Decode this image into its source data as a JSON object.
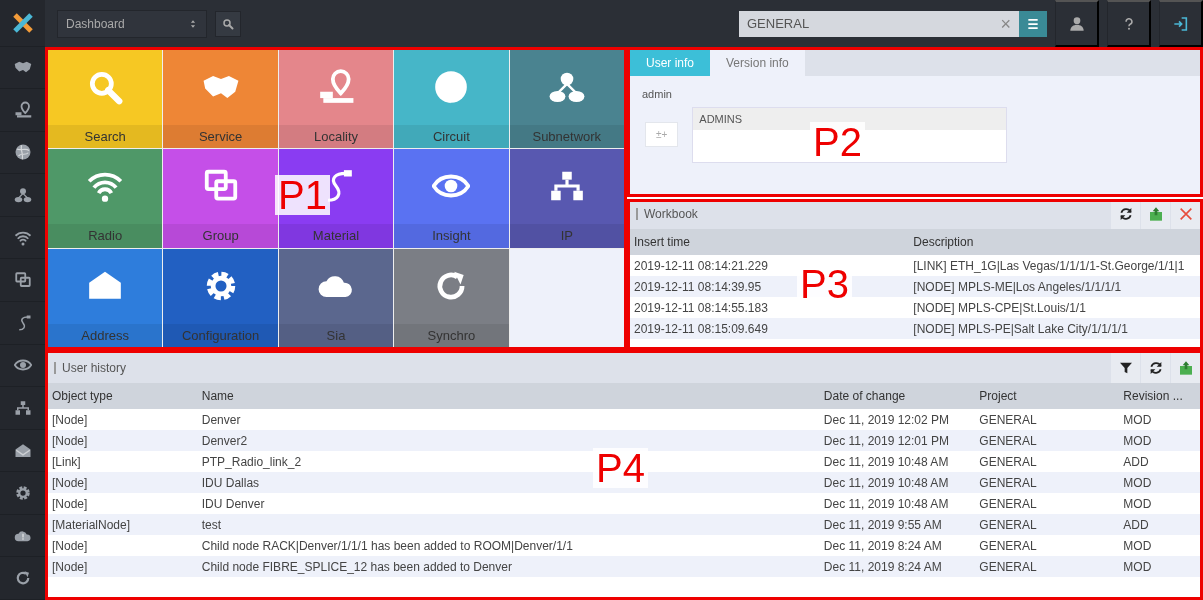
{
  "topbar": {
    "view_select": {
      "value": "Dashboard"
    },
    "project_field": {
      "value": "GENERAL",
      "clear": "×"
    }
  },
  "tiles": [
    {
      "label": "Search",
      "color": "#f6c823"
    },
    {
      "label": "Service",
      "color": "#ee8636"
    },
    {
      "label": "Locality",
      "color": "#e4868b"
    },
    {
      "label": "Circuit",
      "color": "#46b6c8"
    },
    {
      "label": "Subnetwork",
      "color": "#4a8390"
    },
    {
      "label": "Radio",
      "color": "#4f9868"
    },
    {
      "label": "Group",
      "color": "#c54fe8"
    },
    {
      "label": "Material",
      "color": "#8a3cf2"
    },
    {
      "label": "Insight",
      "color": "#5a72f2"
    },
    {
      "label": "IP",
      "color": "#5858b0"
    },
    {
      "label": "Address",
      "color": "#2e7ddc"
    },
    {
      "label": "Configuration",
      "color": "#2260c2"
    },
    {
      "label": "Sia",
      "color": "#5b678e"
    },
    {
      "label": "Synchro",
      "color": "#7b7e85"
    }
  ],
  "user_panel": {
    "tabs": [
      {
        "label": "User info",
        "selected": true
      },
      {
        "label": "Version info",
        "selected": false
      }
    ],
    "username": "admin",
    "add_button": "±+",
    "groups": [
      "ADMINS"
    ]
  },
  "workbook": {
    "title": "Workbook",
    "columns": [
      "Insert time",
      "Description"
    ],
    "rows": [
      [
        "2019-12-11 08:14:21.229",
        "[LINK] ETH_1G|Las Vegas/1/1/1/1-St.George/1/1|1"
      ],
      [
        "2019-12-11 08:14:39.95",
        "[NODE] MPLS-ME|Los Angeles/1/1/1/1"
      ],
      [
        "2019-12-11 08:14:55.183",
        "[NODE] MPLS-CPE|St.Louis/1/1"
      ],
      [
        "2019-12-11 08:15:09.649",
        "[NODE] MPLS-PE|Salt Lake City/1/1/1/1"
      ]
    ]
  },
  "user_history": {
    "title": "User history",
    "columns": [
      "Object type",
      "Name",
      "Date of change",
      "Project",
      "Revision ..."
    ],
    "rows": [
      [
        "[Node]",
        "Denver",
        "Dec 11, 2019 12:02 PM",
        "GENERAL",
        "MOD"
      ],
      [
        "[Node]",
        "Denver2",
        "Dec 11, 2019 12:01 PM",
        "GENERAL",
        "MOD"
      ],
      [
        "[Link]",
        "PTP_Radio_link_2",
        "Dec 11, 2019 10:48 AM",
        "GENERAL",
        "ADD"
      ],
      [
        "[Node]",
        "IDU Dallas",
        "Dec 11, 2019 10:48 AM",
        "GENERAL",
        "MOD"
      ],
      [
        "[Node]",
        "IDU Denver",
        "Dec 11, 2019 10:48 AM",
        "GENERAL",
        "MOD"
      ],
      [
        "[MaterialNode]",
        "test",
        "Dec 11, 2019 9:55 AM",
        "GENERAL",
        "ADD"
      ],
      [
        "[Node]",
        "Child node RACK|Denver/1/1/1 has been added to ROOM|Denver/1/1",
        "Dec 11, 2019 8:24 AM",
        "GENERAL",
        "MOD"
      ],
      [
        "[Node]",
        "Child node FIBRE_SPLICE_12 has been added to Denver",
        "Dec 11, 2019 8:24 AM",
        "GENERAL",
        "MOD"
      ]
    ]
  },
  "annotations": [
    {
      "label": "P1"
    },
    {
      "label": "P2"
    },
    {
      "label": "P3"
    },
    {
      "label": "P4"
    }
  ]
}
